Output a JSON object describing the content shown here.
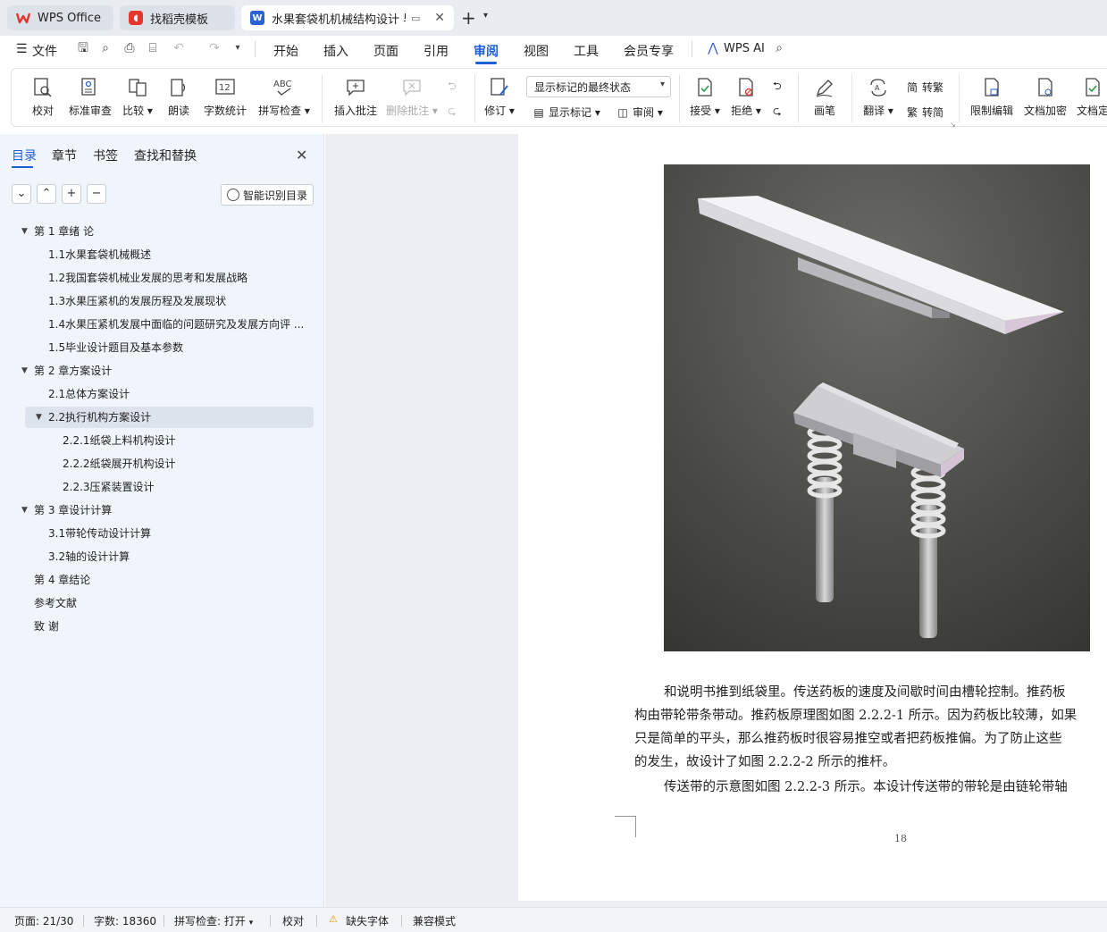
{
  "tabs": [
    {
      "label": "WPS Office",
      "icon": "wps-logo-icon"
    },
    {
      "label": "找稻壳模板",
      "icon": "docer-icon"
    },
    {
      "label": "水果套袋机机械结构设计 毕业",
      "icon": "word-doc-icon"
    }
  ],
  "menu": {
    "file": "文件",
    "items": [
      "开始",
      "插入",
      "页面",
      "引用",
      "审阅",
      "视图",
      "工具",
      "会员专享"
    ],
    "active": "审阅",
    "wps_ai": "WPS AI"
  },
  "ribbon": {
    "proofread": "校对",
    "standard_review": "标准审查",
    "compare": "比较",
    "read_aloud": "朗读",
    "word_count": "字数统计",
    "spell_check": "拼写检查",
    "insert_comment": "插入批注",
    "delete_comment": "删除批注",
    "track_changes": "修订",
    "markup_state": "显示标记的最终状态",
    "show_markup": "显示标记",
    "review_pane": "审阅",
    "accept": "接受",
    "reject": "拒绝",
    "ink": "画笔",
    "translate": "翻译",
    "to_traditional": "转繁",
    "to_simplified": "转简",
    "restrict_edit": "限制编辑",
    "encrypt_doc": "文档加密",
    "doc_final": "文档定",
    "word_count_icon_text": "12",
    "spell_icon_text": "ABC",
    "trad_glyph": "简",
    "simp_glyph": "繁"
  },
  "sidebar": {
    "tabs": [
      "目录",
      "章节",
      "书签",
      "查找和替换"
    ],
    "active_tab": "目录",
    "smart_toc": "智能识别目录",
    "controls": [
      "⌄",
      "⌃",
      "+",
      "−"
    ],
    "toc": [
      {
        "label": "第 1 章绪  论",
        "level": 1,
        "expanded": true
      },
      {
        "label": "1.1水果套袋机械概述",
        "level": 2
      },
      {
        "label": "1.2我国套袋机械业发展的思考和发展战略",
        "level": 2
      },
      {
        "label": "1.3水果压紧机的发展历程及发展现状",
        "level": 2
      },
      {
        "label": "1.4水果压紧机发展中面临的问题研究及发展方向评 ...",
        "level": 2
      },
      {
        "label": "1.5毕业设计题目及基本参数",
        "level": 2
      },
      {
        "label": "第 2 章方案设计",
        "level": 1,
        "expanded": true
      },
      {
        "label": "2.1总体方案设计",
        "level": 2
      },
      {
        "label": "2.2执行机构方案设计",
        "level": 2,
        "expanded": true,
        "selected": true
      },
      {
        "label": "2.2.1纸袋上料机构设计",
        "level": 3
      },
      {
        "label": "2.2.2纸袋展开机构设计",
        "level": 3
      },
      {
        "label": "2.2.3压紧装置设计",
        "level": 3
      },
      {
        "label": "第 3 章设计计算",
        "level": 1,
        "expanded": true
      },
      {
        "label": "3.1带轮传动设计计算",
        "level": 2
      },
      {
        "label": "3.2轴的设计计算",
        "level": 2
      },
      {
        "label": "第 4 章结论",
        "level": 1
      },
      {
        "label": "参考文献",
        "level": 1
      },
      {
        "label": "致  谢",
        "level": 1
      }
    ]
  },
  "document": {
    "paragraphs": [
      "和说明书推到纸袋里。传送药板的速度及间歇时间由槽轮控制。推药板",
      "构由带轮带条带动。推药板原理图如图 2.2.2-1 所示。因为药板比较薄，如果",
      "只是简单的平头，那么推药板时很容易推空或者把药板推偏。为了防止这些",
      "的发生，故设计了如图 2.2.2-2 所示的推杆。",
      "传送带的示意图如图 2.2.2-3 所示。本设计传送带的带轮是由链轮带轴"
    ],
    "page_number": "18"
  },
  "statusbar": {
    "page": "页面: 21/30",
    "words": "字数: 18360",
    "spell": "拼写检查: 打开",
    "proof": "校对",
    "missing_font": "缺失字体",
    "compat": "兼容模式"
  },
  "colors": {
    "accent": "#1f5fd6",
    "wps_red": "#e5352c",
    "sidebar_bg": "#f0f5fb",
    "selected_row": "#dde3ec"
  }
}
